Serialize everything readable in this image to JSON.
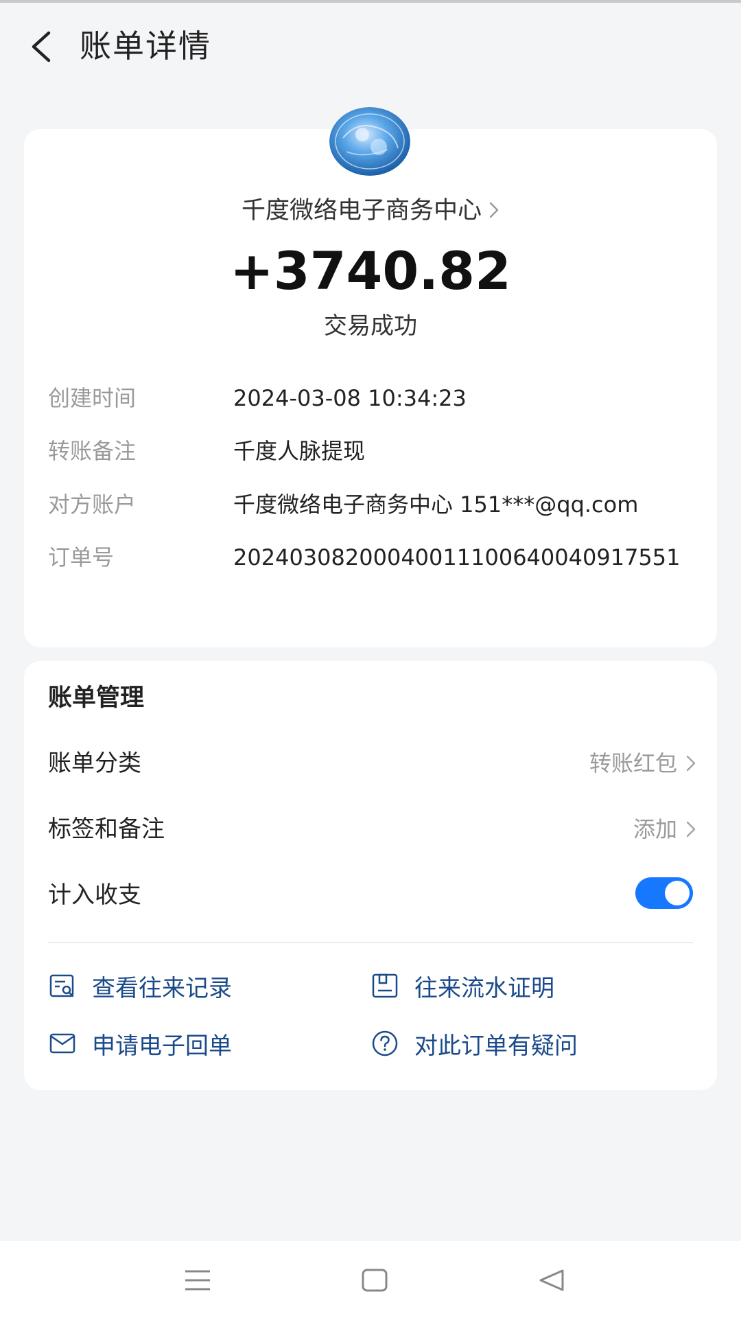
{
  "header": {
    "title": "账单详情"
  },
  "merchant": {
    "name": "千度微络电子商务中心"
  },
  "amount": "+3740.82",
  "status": "交易成功",
  "details": [
    {
      "label": "创建时间",
      "value": "2024-03-08 10:34:23"
    },
    {
      "label": "转账备注",
      "value": "千度人脉提现"
    },
    {
      "label": "对方账户",
      "value": "千度微络电子商务中心 151***@qq.com"
    },
    {
      "label": "订单号",
      "value": "20240308200040011100640040917551"
    }
  ],
  "manage": {
    "title": "账单管理",
    "category_label": "账单分类",
    "category_value": "转账红包",
    "tags_label": "标签和备注",
    "tags_value": "添加",
    "include_label": "计入收支",
    "include_enabled": true
  },
  "actions": {
    "records": "查看往来记录",
    "statement": "往来流水证明",
    "receipt": "申请电子回单",
    "question": "对此订单有疑问"
  },
  "colors": {
    "accent": "#1677ff",
    "action_text": "#1b4a8a",
    "background": "#f4f5f7"
  },
  "icons": {
    "back": "back-arrow-icon",
    "records": "records-search-icon",
    "statement": "document-icon",
    "receipt": "envelope-icon",
    "question": "question-circle-icon"
  }
}
